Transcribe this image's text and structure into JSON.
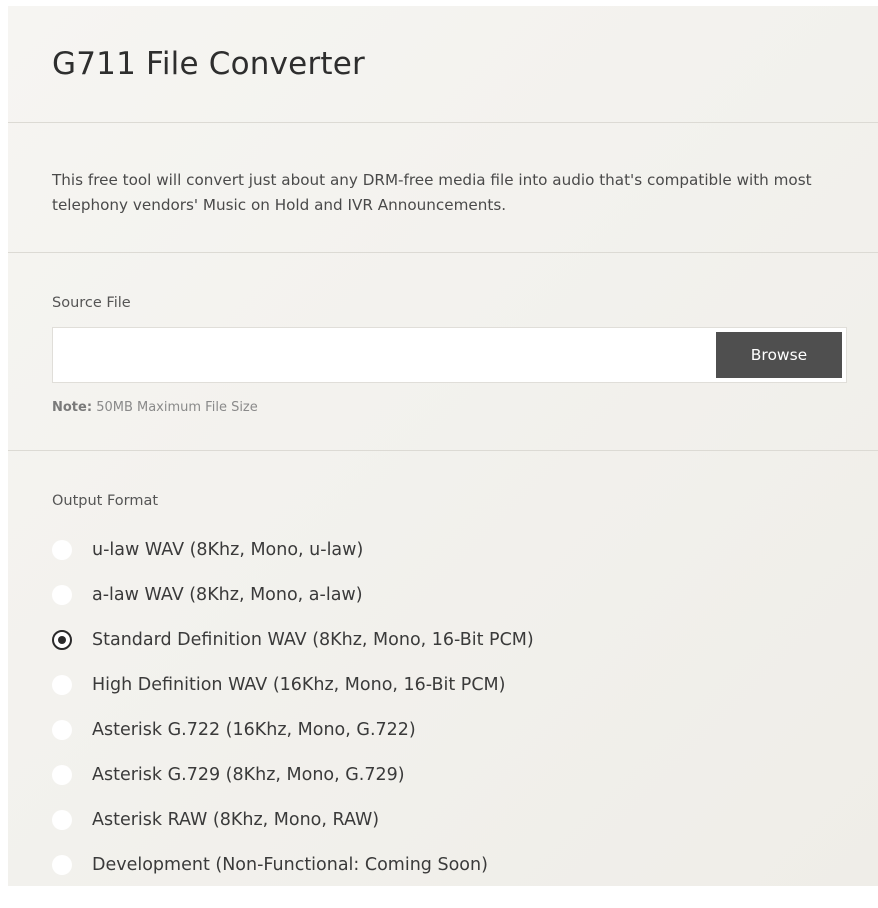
{
  "header": {
    "title": "G711 File Converter"
  },
  "description": "This free tool will convert just about any DRM-free media file into audio that's compatible with most telephony vendors' Music on Hold and IVR Announcements.",
  "source": {
    "label": "Source File",
    "input_value": "",
    "browse_label": "Browse",
    "note_prefix": "Note:",
    "note_text": "50MB Maximum File Size"
  },
  "output": {
    "label": "Output Format",
    "selected": "Standard Definition WAV (8Khz, Mono, 16-Bit PCM)",
    "options": [
      "u-law WAV (8Khz, Mono, u-law)",
      "a-law WAV (8Khz, Mono, a-law)",
      "Standard Definition WAV (8Khz, Mono, 16-Bit PCM)",
      "High Definition WAV (16Khz, Mono, 16-Bit PCM)",
      "Asterisk G.722 (16Khz, Mono, G.722)",
      "Asterisk G.729 (8Khz, Mono, G.729)",
      "Asterisk RAW (8Khz, Mono, RAW)",
      "Development (Non-Functional: Coming Soon)"
    ]
  },
  "colors": {
    "panel_background": "#f4f3ef",
    "button_background": "#4f4f4f",
    "button_text": "#ffffff",
    "radio_checked": "#2b2b2b"
  }
}
